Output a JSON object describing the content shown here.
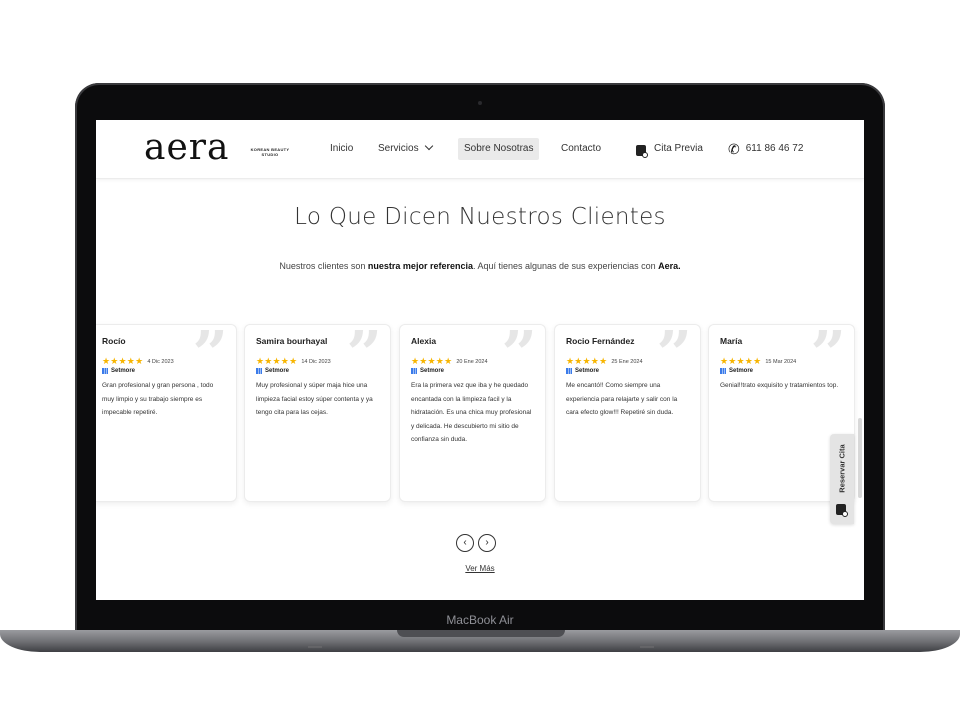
{
  "device": {
    "model_label": "MacBook Air"
  },
  "header": {
    "logo": "aera",
    "logo_sub": "KOREAN BEAUTY STUDIO",
    "nav": {
      "inicio": "Inicio",
      "servicios": "Servicios",
      "sobre": "Sobre Nosotras",
      "contacto": "Contacto",
      "cita": "Cita Previa",
      "phone": "611 86 46 72"
    }
  },
  "section": {
    "title": "Lo Que Dicen Nuestros Clientes",
    "intro_a": "Nuestros clientes son ",
    "intro_b": "nuestra mejor referencia",
    "intro_c": ". Aquí tienes algunas de sus experiencias con ",
    "intro_d": "Aera."
  },
  "reviews": [
    {
      "name": "Rocío",
      "stars": "★★★★★",
      "date": "4 Dic 2023",
      "source": "Setmore",
      "text": "Gran profesional y gran persona , todo muy limpio y su trabajo siempre es impecable repetiré."
    },
    {
      "name": "Samira bourhayal",
      "stars": "★★★★★",
      "date": "14 Dic 2023",
      "source": "Setmore",
      "text": "Muy profesional y súper maja hice una limpieza facial estoy súper contenta y ya tengo cita para las cejas."
    },
    {
      "name": "Alexia",
      "stars": "★★★★★",
      "date": "20 Ene 2024",
      "source": "Setmore",
      "text": "Era la primera vez que iba y he quedado encantada con la limpieza facil y la hidratación. Es una chica muy profesional y delicada. He descubierto mi sitio de confianza sin duda."
    },
    {
      "name": "Rocio Fernández",
      "stars": "★★★★★",
      "date": "25 Ene 2024",
      "source": "Setmore",
      "text": "Me encantó!! Como siempre una experiencia para relajarte y salir con la cara efecto glow!!! Repetiré sin duda."
    },
    {
      "name": "María",
      "stars": "★★★★★",
      "date": "15 Mar 2024",
      "source": "Setmore",
      "text": "Genial!!trato exquisito y tratamientos top."
    }
  ],
  "carousel": {
    "prev": "‹",
    "next": "›",
    "more": "Ver Más"
  },
  "side_tab": {
    "label": "Reservar Cita"
  },
  "colors": {
    "star": "#f7b500",
    "accent_bg": "#eaeaea"
  },
  "icons": {
    "calendar": "calendar-icon",
    "phone": "phone-icon",
    "quote": "quote-icon",
    "setmore": "setmore-icon"
  }
}
